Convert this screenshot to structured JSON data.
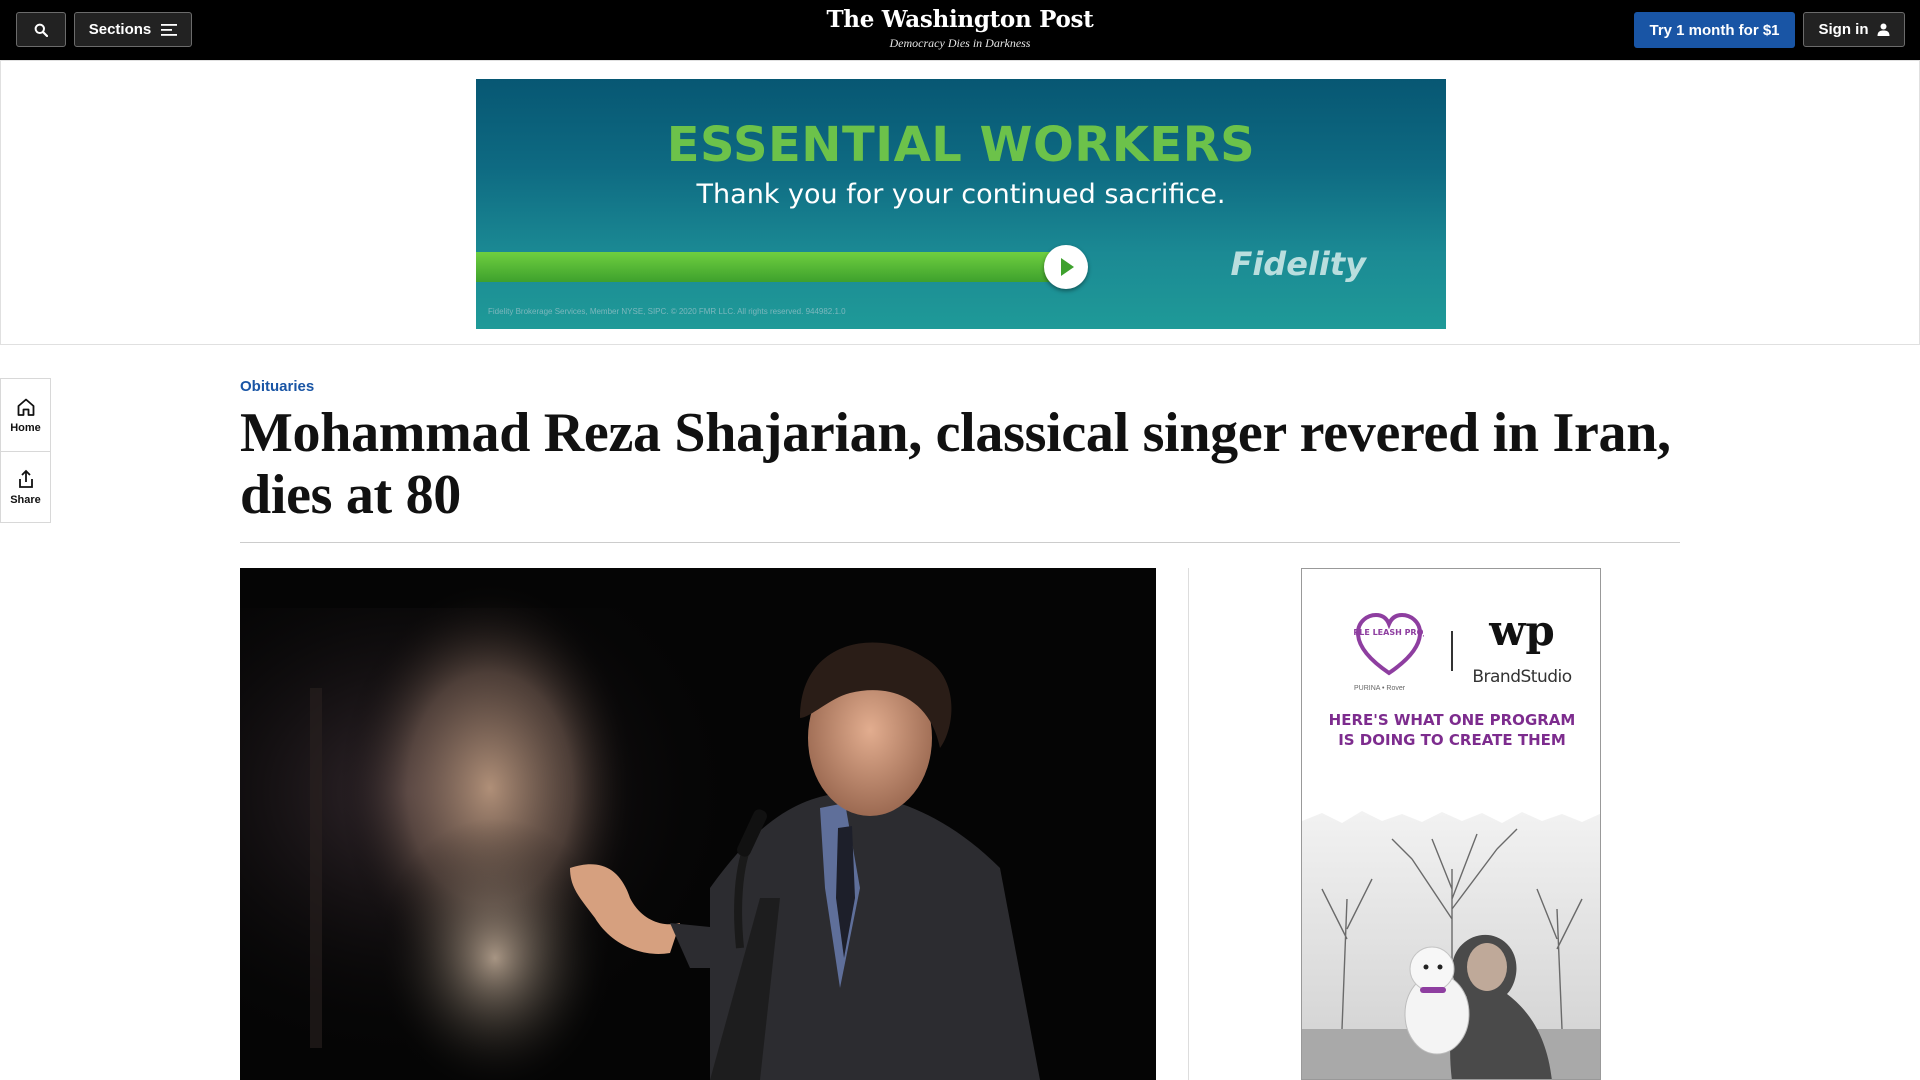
{
  "header": {
    "sections_label": "Sections",
    "brand_name": "The Washington Post",
    "tagline": "Democracy Dies in Darkness",
    "subscribe_label": "Try 1 month for $1",
    "signin_label": "Sign in",
    "icons": [
      "search-icon",
      "menu-icon",
      "user-icon"
    ]
  },
  "banner_ad": {
    "headline": "ESSENTIAL WORKERS",
    "subhead": "Thank you for your continued sacrifice.",
    "brand": "Fidelity",
    "disclaimer": "Fidelity Brokerage Services, Member NYSE, SIPC. © 2020 FMR LLC. All rights reserved. 944982.1.0",
    "colors": {
      "background": "#0e6a82",
      "headline": "#6cc24a"
    }
  },
  "rail": {
    "home_label": "Home",
    "share_label": "Share"
  },
  "article": {
    "kicker": "Obituaries",
    "headline": "Mohammad Reza Shajarian, classical singer revered in Iran, dies at 80",
    "colors": {
      "kicker": "#1955a5"
    }
  },
  "side_ad": {
    "sponsor_logo_text": "PURPLE LEASH PROJECT",
    "sponsor_partners": "PURINA • Rover",
    "publisher_mark": "wp",
    "publisher_label": "BrandStudio",
    "headline": "HERE'S WHAT ONE PROGRAM IS DOING TO CREATE THEM",
    "colors": {
      "headline": "#7d2c8e"
    }
  }
}
